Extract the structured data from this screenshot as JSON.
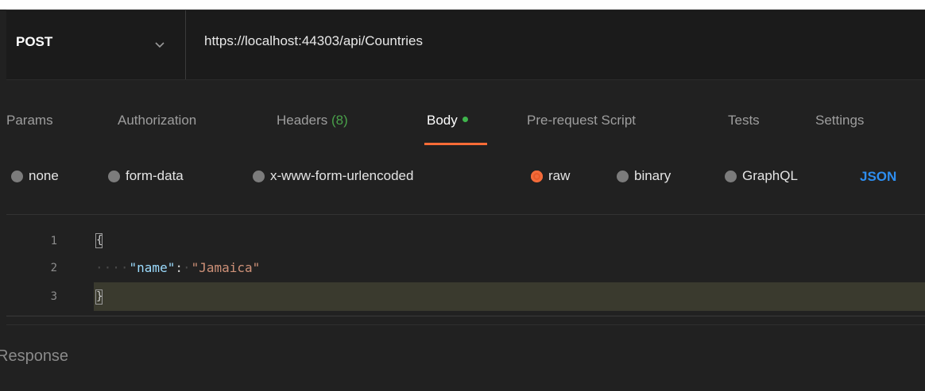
{
  "request": {
    "method": "POST",
    "url": "https://localhost:44303/api/Countries"
  },
  "tabs": [
    {
      "label": "Params"
    },
    {
      "label": "Authorization"
    },
    {
      "label": "Headers",
      "count": "(8)"
    },
    {
      "label": "Body"
    },
    {
      "label": "Pre-request Script"
    },
    {
      "label": "Tests"
    },
    {
      "label": "Settings"
    }
  ],
  "active_tab": "Body",
  "body_types": [
    {
      "label": "none"
    },
    {
      "label": "form-data"
    },
    {
      "label": "x-www-form-urlencoded"
    },
    {
      "label": "raw"
    },
    {
      "label": "binary"
    },
    {
      "label": "GraphQL"
    }
  ],
  "selected_body_type": "raw",
  "format": "JSON",
  "editor": {
    "lines": [
      {
        "num": "1",
        "open": "{"
      },
      {
        "num": "2",
        "key": "\"name\"",
        "sep": ":",
        "value": "\"Jamaica\""
      },
      {
        "num": "3",
        "close": "}"
      }
    ]
  },
  "response": {
    "label": "Response"
  },
  "colors": {
    "accent": "#ff6c37",
    "link": "#2e8ef0",
    "status_green": "#3fb54c"
  },
  "icons": {
    "method_dropdown": "chevron-down-icon",
    "radio": "radio-icon"
  }
}
